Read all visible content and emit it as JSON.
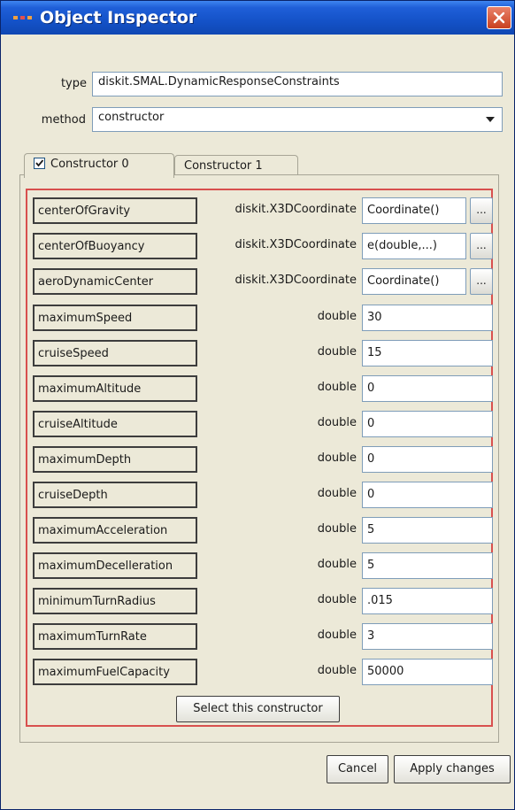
{
  "window": {
    "title": "Object Inspector"
  },
  "type_row": {
    "label": "type",
    "value": "diskit.SMAL.DynamicResponseConstraints"
  },
  "method_row": {
    "label": "method",
    "selected": "constructor"
  },
  "tabs": [
    {
      "label": "Constructor 0",
      "checked": true
    },
    {
      "label": "Constructor 1"
    }
  ],
  "params": [
    {
      "name": "centerOfGravity",
      "type": "diskit.X3DCoordinate",
      "value": "Coordinate()",
      "has_button": true
    },
    {
      "name": "centerOfBuoyancy",
      "type": "diskit.X3DCoordinate",
      "value": "e(double,...)",
      "has_button": true
    },
    {
      "name": "aeroDynamicCenter",
      "type": "diskit.X3DCoordinate",
      "value": "Coordinate()",
      "has_button": true
    },
    {
      "name": "maximumSpeed",
      "type": "double",
      "value": "30"
    },
    {
      "name": "cruiseSpeed",
      "type": "double",
      "value": "15"
    },
    {
      "name": "maximumAltitude",
      "type": "double",
      "value": "0"
    },
    {
      "name": "cruiseAltitude",
      "type": "double",
      "value": "0"
    },
    {
      "name": "maximumDepth",
      "type": "double",
      "value": "0"
    },
    {
      "name": "cruiseDepth",
      "type": "double",
      "value": "0"
    },
    {
      "name": "maximumAcceleration",
      "type": "double",
      "value": "5"
    },
    {
      "name": "maximumDecelleration",
      "type": "double",
      "value": "5"
    },
    {
      "name": "minimumTurnRadius",
      "type": "double",
      "value": ".015"
    },
    {
      "name": "maximumTurnRate",
      "type": "double",
      "value": "3"
    },
    {
      "name": "maximumFuelCapacity",
      "type": "double",
      "value": "50000"
    }
  ],
  "ellipsis_label": "...",
  "buttons": {
    "select_constructor": "Select this constructor",
    "cancel": "Cancel",
    "apply": "Apply changes"
  },
  "colors": {
    "title_bar": "#1452c8",
    "close_button": "#d9532f",
    "inner_border": "#d8504e",
    "background": "#ece9d8"
  }
}
